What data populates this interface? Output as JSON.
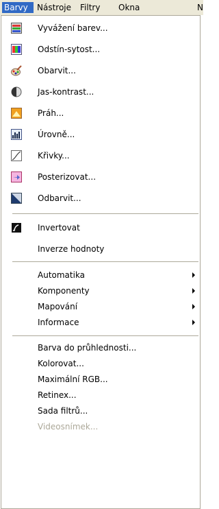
{
  "menubar": {
    "items": [
      {
        "label": "Barvy"
      },
      {
        "label": "Nástroje"
      },
      {
        "label": "Filtry"
      },
      {
        "label": "Okna"
      },
      {
        "label": "N"
      }
    ]
  },
  "menu": {
    "group1": [
      {
        "label": "Vyvážení barev...",
        "icon": "color-balance-icon"
      },
      {
        "label": "Odstín-sytost...",
        "icon": "hue-saturation-icon"
      },
      {
        "label": "Obarvit...",
        "icon": "colorize-icon"
      },
      {
        "label": "Jas-kontrast...",
        "icon": "brightness-contrast-icon"
      },
      {
        "label": "Práh...",
        "icon": "threshold-icon"
      },
      {
        "label": "Úrovně...",
        "icon": "levels-icon"
      },
      {
        "label": "Křivky...",
        "icon": "curves-icon"
      },
      {
        "label": "Posterizovat...",
        "icon": "posterize-icon"
      },
      {
        "label": "Odbarvit...",
        "icon": "desaturate-icon"
      }
    ],
    "group2": [
      {
        "label": "Invertovat",
        "icon": "invert-icon"
      },
      {
        "label": "Inverze hodnoty"
      }
    ],
    "group3": [
      {
        "label": "Automatika"
      },
      {
        "label": "Komponenty"
      },
      {
        "label": "Mapování"
      },
      {
        "label": "Informace"
      }
    ],
    "group4": [
      {
        "label": "Barva do průhlednosti..."
      },
      {
        "label": "Kolorovat..."
      },
      {
        "label": "Maximální RGB..."
      },
      {
        "label": "Retinex..."
      },
      {
        "label": "Sada filtrů..."
      },
      {
        "label": "Videosnímek..."
      }
    ]
  },
  "colors": {
    "highlight": "#316ac5",
    "menubar": "#ece9d8",
    "disabled_text": "#aca899"
  }
}
